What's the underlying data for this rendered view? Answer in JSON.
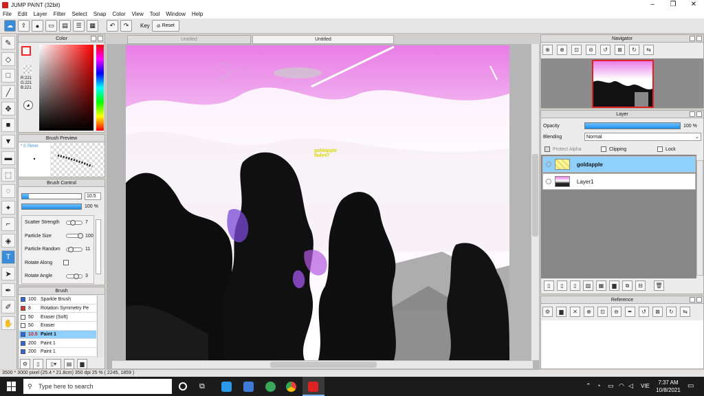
{
  "app": {
    "title": "JUMP PAINT (32bit)"
  },
  "menu": [
    "File",
    "Edit",
    "Layer",
    "Filter",
    "Select",
    "Snap",
    "Color",
    "View",
    "Tool",
    "Window",
    "Help"
  ],
  "toolbar": {
    "key_label": "Key",
    "reset_label": "Reset"
  },
  "color_panel": {
    "title": "Color",
    "r": "R:221",
    "g": "G:221",
    "b": "B:221",
    "fg": "#ffffff",
    "bg": "#e77ce3",
    "fg_border": "#ff2020"
  },
  "brush_preview": {
    "title": "Brush Preview",
    "size_label": "* 0.76mm"
  },
  "brush_control": {
    "title": "Brush Control",
    "size_value": "10.5",
    "size_fraction": 0.12,
    "opacity_value": "100 %",
    "opacity_fraction": 1.0,
    "params": [
      {
        "label": "Scatter Strength",
        "value": "7",
        "fraction": 0.3
      },
      {
        "label": "Particle Size",
        "value": "100",
        "fraction": 1.0
      },
      {
        "label": "Particle Random",
        "value": "11",
        "fraction": 0.15
      },
      {
        "label": "Rotate Along",
        "value": "",
        "fraction": null
      },
      {
        "label": "Rotate Angle",
        "value": "3",
        "fraction": 0.6
      }
    ]
  },
  "brush_list": {
    "title": "Brush",
    "items": [
      {
        "size": "100",
        "name": "Sparkle Brush",
        "color": "#3366dd",
        "selected": false
      },
      {
        "size": "8",
        "name": "Rotation Symmetry Pe",
        "color": "#dd3333",
        "selected": false
      },
      {
        "size": "50",
        "name": "Eraser (Soft)",
        "color": "#ffffff",
        "selected": false
      },
      {
        "size": "50",
        "name": "Eraser",
        "color": "#ffffff",
        "selected": false
      },
      {
        "size": "10.5",
        "name": "Paint 1",
        "color": "#3366dd",
        "selected": true
      },
      {
        "size": "200",
        "name": "Paint 1",
        "color": "#3366dd",
        "selected": false
      },
      {
        "size": "200",
        "name": "Paint 1",
        "color": "#3366dd",
        "selected": false
      }
    ]
  },
  "doc_tabs": [
    "Untitled",
    "Untitled"
  ],
  "canvas_text": {
    "line1": "goldapple",
    "line2": "fade47"
  },
  "navigator": {
    "title": "Navigator"
  },
  "layer_panel": {
    "title": "Layer",
    "opacity_label": "Opacity",
    "opacity_value": "100 %",
    "opacity_fraction": 1.0,
    "blending_label": "Blending",
    "blending_value": "Normal",
    "protect_alpha": "Protect Alpha",
    "clipping": "Clipping",
    "lock": "Lock",
    "layers": [
      {
        "name": "goldapple",
        "selected": true
      },
      {
        "name": "Layer1",
        "selected": false
      }
    ]
  },
  "reference": {
    "title": "Reference"
  },
  "status": {
    "text": "3500 * 3000 pixel  (25.4 * 21.8cm)  350 dpi  25 %  ( 2245, 1859 )"
  },
  "taskbar": {
    "search_placeholder": "Type here to search",
    "lang": "VIE",
    "time": "7:37 AM",
    "date": "10/8/2021"
  }
}
